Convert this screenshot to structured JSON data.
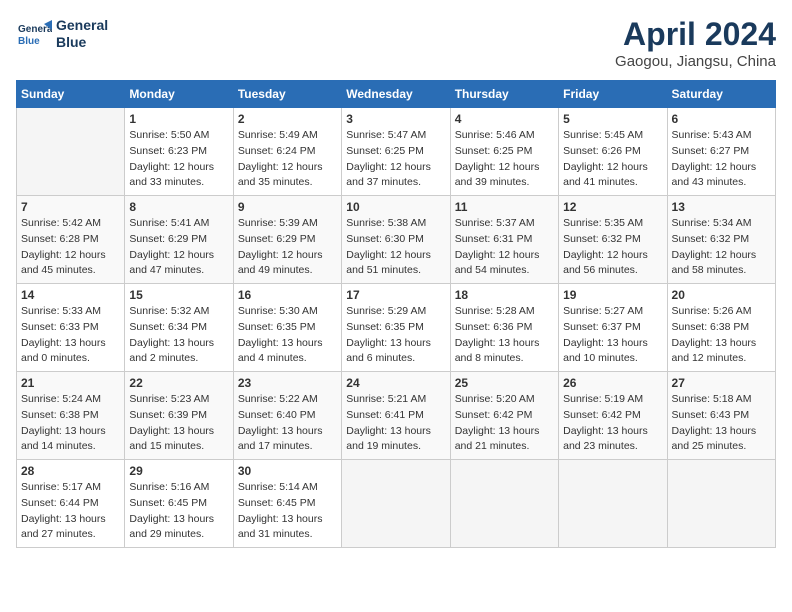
{
  "header": {
    "logo_line1": "General",
    "logo_line2": "Blue",
    "title": "April 2024",
    "subtitle": "Gaogou, Jiangsu, China"
  },
  "days_of_week": [
    "Sunday",
    "Monday",
    "Tuesday",
    "Wednesday",
    "Thursday",
    "Friday",
    "Saturday"
  ],
  "weeks": [
    [
      {
        "day": "",
        "info": ""
      },
      {
        "day": "1",
        "info": "Sunrise: 5:50 AM\nSunset: 6:23 PM\nDaylight: 12 hours\nand 33 minutes."
      },
      {
        "day": "2",
        "info": "Sunrise: 5:49 AM\nSunset: 6:24 PM\nDaylight: 12 hours\nand 35 minutes."
      },
      {
        "day": "3",
        "info": "Sunrise: 5:47 AM\nSunset: 6:25 PM\nDaylight: 12 hours\nand 37 minutes."
      },
      {
        "day": "4",
        "info": "Sunrise: 5:46 AM\nSunset: 6:25 PM\nDaylight: 12 hours\nand 39 minutes."
      },
      {
        "day": "5",
        "info": "Sunrise: 5:45 AM\nSunset: 6:26 PM\nDaylight: 12 hours\nand 41 minutes."
      },
      {
        "day": "6",
        "info": "Sunrise: 5:43 AM\nSunset: 6:27 PM\nDaylight: 12 hours\nand 43 minutes."
      }
    ],
    [
      {
        "day": "7",
        "info": "Sunrise: 5:42 AM\nSunset: 6:28 PM\nDaylight: 12 hours\nand 45 minutes."
      },
      {
        "day": "8",
        "info": "Sunrise: 5:41 AM\nSunset: 6:29 PM\nDaylight: 12 hours\nand 47 minutes."
      },
      {
        "day": "9",
        "info": "Sunrise: 5:39 AM\nSunset: 6:29 PM\nDaylight: 12 hours\nand 49 minutes."
      },
      {
        "day": "10",
        "info": "Sunrise: 5:38 AM\nSunset: 6:30 PM\nDaylight: 12 hours\nand 51 minutes."
      },
      {
        "day": "11",
        "info": "Sunrise: 5:37 AM\nSunset: 6:31 PM\nDaylight: 12 hours\nand 54 minutes."
      },
      {
        "day": "12",
        "info": "Sunrise: 5:35 AM\nSunset: 6:32 PM\nDaylight: 12 hours\nand 56 minutes."
      },
      {
        "day": "13",
        "info": "Sunrise: 5:34 AM\nSunset: 6:32 PM\nDaylight: 12 hours\nand 58 minutes."
      }
    ],
    [
      {
        "day": "14",
        "info": "Sunrise: 5:33 AM\nSunset: 6:33 PM\nDaylight: 13 hours\nand 0 minutes."
      },
      {
        "day": "15",
        "info": "Sunrise: 5:32 AM\nSunset: 6:34 PM\nDaylight: 13 hours\nand 2 minutes."
      },
      {
        "day": "16",
        "info": "Sunrise: 5:30 AM\nSunset: 6:35 PM\nDaylight: 13 hours\nand 4 minutes."
      },
      {
        "day": "17",
        "info": "Sunrise: 5:29 AM\nSunset: 6:35 PM\nDaylight: 13 hours\nand 6 minutes."
      },
      {
        "day": "18",
        "info": "Sunrise: 5:28 AM\nSunset: 6:36 PM\nDaylight: 13 hours\nand 8 minutes."
      },
      {
        "day": "19",
        "info": "Sunrise: 5:27 AM\nSunset: 6:37 PM\nDaylight: 13 hours\nand 10 minutes."
      },
      {
        "day": "20",
        "info": "Sunrise: 5:26 AM\nSunset: 6:38 PM\nDaylight: 13 hours\nand 12 minutes."
      }
    ],
    [
      {
        "day": "21",
        "info": "Sunrise: 5:24 AM\nSunset: 6:38 PM\nDaylight: 13 hours\nand 14 minutes."
      },
      {
        "day": "22",
        "info": "Sunrise: 5:23 AM\nSunset: 6:39 PM\nDaylight: 13 hours\nand 15 minutes."
      },
      {
        "day": "23",
        "info": "Sunrise: 5:22 AM\nSunset: 6:40 PM\nDaylight: 13 hours\nand 17 minutes."
      },
      {
        "day": "24",
        "info": "Sunrise: 5:21 AM\nSunset: 6:41 PM\nDaylight: 13 hours\nand 19 minutes."
      },
      {
        "day": "25",
        "info": "Sunrise: 5:20 AM\nSunset: 6:42 PM\nDaylight: 13 hours\nand 21 minutes."
      },
      {
        "day": "26",
        "info": "Sunrise: 5:19 AM\nSunset: 6:42 PM\nDaylight: 13 hours\nand 23 minutes."
      },
      {
        "day": "27",
        "info": "Sunrise: 5:18 AM\nSunset: 6:43 PM\nDaylight: 13 hours\nand 25 minutes."
      }
    ],
    [
      {
        "day": "28",
        "info": "Sunrise: 5:17 AM\nSunset: 6:44 PM\nDaylight: 13 hours\nand 27 minutes."
      },
      {
        "day": "29",
        "info": "Sunrise: 5:16 AM\nSunset: 6:45 PM\nDaylight: 13 hours\nand 29 minutes."
      },
      {
        "day": "30",
        "info": "Sunrise: 5:14 AM\nSunset: 6:45 PM\nDaylight: 13 hours\nand 31 minutes."
      },
      {
        "day": "",
        "info": ""
      },
      {
        "day": "",
        "info": ""
      },
      {
        "day": "",
        "info": ""
      },
      {
        "day": "",
        "info": ""
      }
    ]
  ]
}
